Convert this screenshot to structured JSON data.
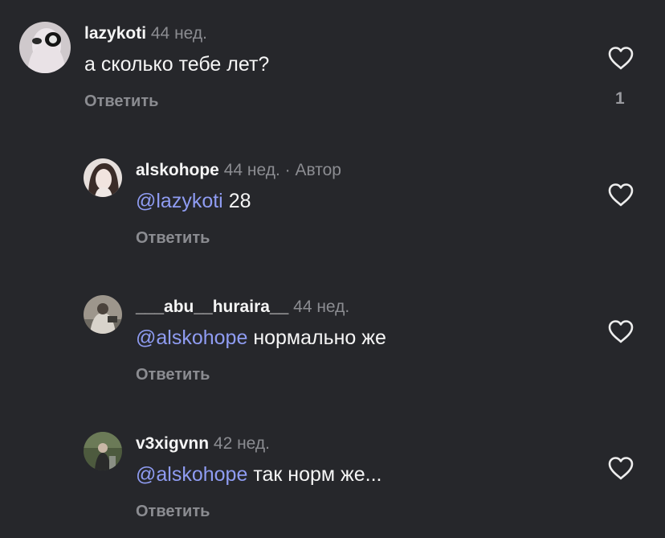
{
  "comments": [
    {
      "username": "lazykoti",
      "age": "44 нед.",
      "author_tag": "",
      "mention": "",
      "text": "а сколько тебе лет?",
      "reply_label": "Ответить",
      "like_icon": "heart-outline-icon",
      "like_count": "1"
    },
    {
      "username": "alskohope",
      "age": "44 нед.",
      "author_tag": "· Автор",
      "mention": "@lazykoti",
      "text": "28",
      "reply_label": "Ответить",
      "like_icon": "heart-outline-icon",
      "like_count": ""
    },
    {
      "username": "___abu__huraira__",
      "age": "44 нед.",
      "author_tag": "",
      "mention": "@alskohope",
      "text": "нормально же",
      "reply_label": "Ответить",
      "like_icon": "heart-outline-icon",
      "like_count": ""
    },
    {
      "username": "v3xigvnn",
      "age": "42 нед.",
      "author_tag": "",
      "mention": "@alskohope",
      "text": "так норм же...",
      "reply_label": "Ответить",
      "like_icon": "heart-outline-icon",
      "like_count": ""
    }
  ],
  "colors": {
    "background": "#26272b",
    "mention": "#8f9cf2",
    "secondary_text": "#8b8c91"
  }
}
